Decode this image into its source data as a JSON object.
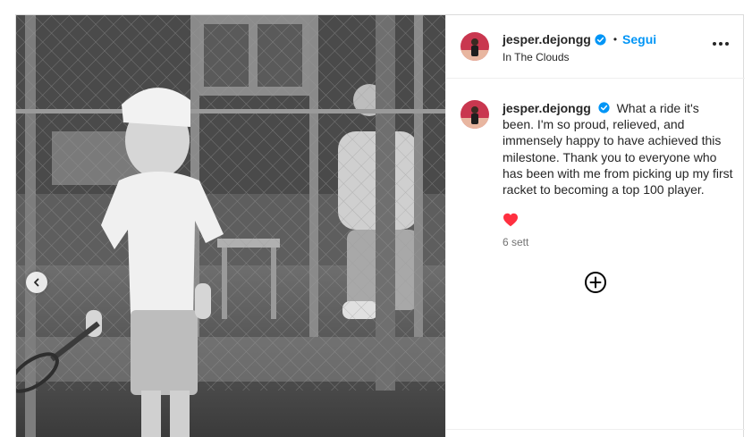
{
  "post": {
    "username": "jesper.dejongg",
    "follow_label": "Segui",
    "separator": "•",
    "location": "In The Clouds",
    "caption": "What a ride it's been. I'm so proud, relieved, and immensely happy to have achieved this milestone. Thank you to everyone who has been with me from picking up my first racket to becoming a top 100 player.",
    "time_ago": "6 sett",
    "liked": true
  },
  "icons": {
    "verified": "verified-badge-icon",
    "more": "more-options-icon",
    "carousel_prev": "chevron-left-icon",
    "like": "heart-filled-icon",
    "add": "plus-circle-icon"
  },
  "colors": {
    "accent": "#0095f6",
    "verified": "#0095f6",
    "like": "#ff3040",
    "text": "#262626",
    "muted": "#737373"
  }
}
